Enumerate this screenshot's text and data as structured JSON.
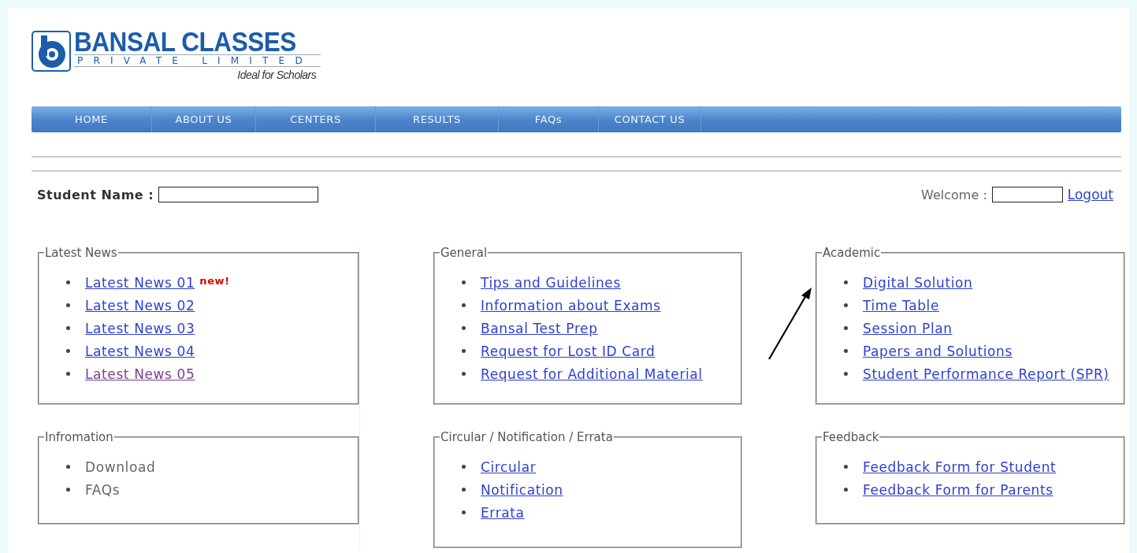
{
  "logo": {
    "name": "BANSAL CLASSES",
    "subtitle": "PRIVATE LIMITED",
    "tagline": "Ideal for Scholars"
  },
  "nav": [
    "HOME",
    "ABOUT US",
    "CENTERS",
    "RESULTS",
    "FAQs",
    "CONTACT US"
  ],
  "student_name": {
    "label": "Student Name :"
  },
  "welcome": {
    "label": "Welcome :",
    "logout": "Logout"
  },
  "columns": [
    [
      {
        "title": "Latest News",
        "items": [
          {
            "text": "Latest News 01",
            "kind": "link",
            "visited": false,
            "badge": "new!"
          },
          {
            "text": "Latest News 02",
            "kind": "link",
            "visited": false
          },
          {
            "text": "Latest News 03",
            "kind": "link",
            "visited": false
          },
          {
            "text": "Latest News 04",
            "kind": "link",
            "visited": false
          },
          {
            "text": "Latest News 05",
            "kind": "link",
            "visited": true
          }
        ]
      },
      {
        "title": "Infromation",
        "items": [
          {
            "text": "Download",
            "kind": "text"
          },
          {
            "text": "FAQs",
            "kind": "text"
          }
        ]
      }
    ],
    [
      {
        "title": "General",
        "items": [
          {
            "text": "Tips and Guidelines",
            "kind": "link",
            "visited": false
          },
          {
            "text": "Information about Exams",
            "kind": "link",
            "visited": false
          },
          {
            "text": "Bansal Test Prep",
            "kind": "link",
            "visited": false
          },
          {
            "text": "Request for Lost ID Card",
            "kind": "link",
            "visited": false
          },
          {
            "text": "Request for Additional Material",
            "kind": "link",
            "visited": false
          }
        ]
      },
      {
        "title": "Circular / Notification / Errata",
        "items": [
          {
            "text": "Circular",
            "kind": "link",
            "visited": false
          },
          {
            "text": "Notification",
            "kind": "link",
            "visited": false
          },
          {
            "text": "Errata",
            "kind": "link",
            "visited": false
          }
        ]
      }
    ],
    [
      {
        "title": "Academic",
        "items": [
          {
            "text": "Digital Solution",
            "kind": "link",
            "visited": false
          },
          {
            "text": "Time Table",
            "kind": "link",
            "visited": false
          },
          {
            "text": "Session Plan",
            "kind": "link",
            "visited": false
          },
          {
            "text": "Papers and Solutions",
            "kind": "link",
            "visited": false
          },
          {
            "text": "Student Performance Report (SPR)",
            "kind": "link",
            "visited": false
          }
        ]
      },
      {
        "title": "Feedback",
        "items": [
          {
            "text": "Feedback Form for Student",
            "kind": "link",
            "visited": false
          },
          {
            "text": "Feedback Form for Parents",
            "kind": "link",
            "visited": false
          }
        ]
      }
    ]
  ]
}
